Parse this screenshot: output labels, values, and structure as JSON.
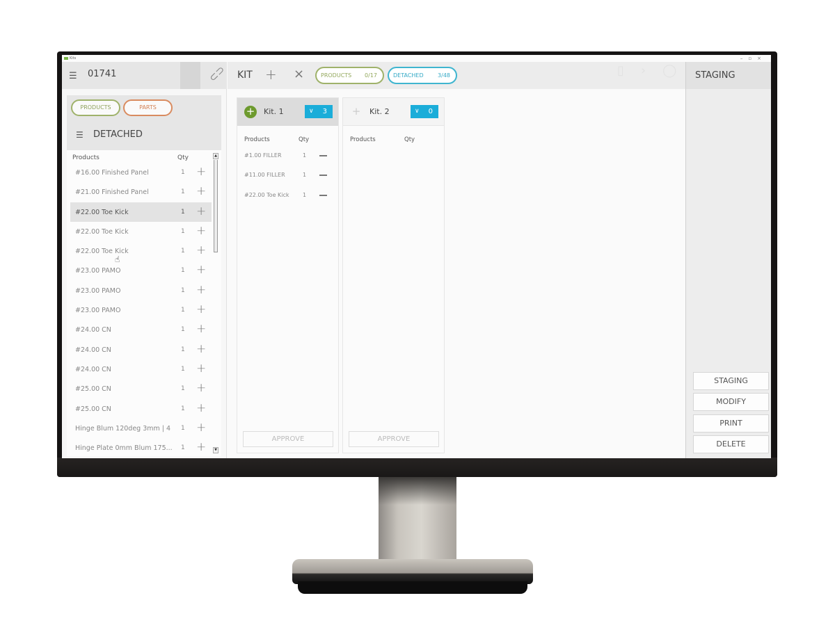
{
  "window": {
    "title": "Kits",
    "controls": [
      "–",
      "▫",
      "×"
    ]
  },
  "left_header": {
    "filter_icon": "sliders-icon",
    "order_number": "01741",
    "link_icon": "link-icon"
  },
  "main_header": {
    "title": "KIT",
    "add_icon": "+",
    "close_icon": "×",
    "pills": [
      {
        "label": "PRODUCTS",
        "count": "0/17",
        "color": "#9fb26a"
      },
      {
        "label": "DETACHED",
        "count": "3/48",
        "color": "#3fb5cf"
      }
    ],
    "faint_icons": [
      "bookmark-icon",
      "chevron-right-icon",
      "lightbulb-icon",
      "home-icon",
      "columns-icon"
    ]
  },
  "right_header": {
    "title": "STAGING"
  },
  "left_panel": {
    "filter_chips": [
      {
        "label": "PRODUCTS",
        "color": "#9fb26a"
      },
      {
        "label": "PARTS",
        "color": "#d98b5f"
      }
    ],
    "section_title": "DETACHED",
    "columns": {
      "product": "Products",
      "qty": "Qty"
    },
    "rows": [
      {
        "name": "#16.00 Finished Panel",
        "qty": "1"
      },
      {
        "name": "#21.00 Finished Panel",
        "qty": "1"
      },
      {
        "name": "#22.00 Toe Kick",
        "qty": "1",
        "hover": true
      },
      {
        "name": "#22.00 Toe Kick",
        "qty": "1"
      },
      {
        "name": "#22.00 Toe Kick",
        "qty": "1"
      },
      {
        "name": "#23.00 PAMO",
        "qty": "1"
      },
      {
        "name": "#23.00 PAMO",
        "qty": "1"
      },
      {
        "name": "#23.00 PAMO",
        "qty": "1"
      },
      {
        "name": "#24.00 CN",
        "qty": "1"
      },
      {
        "name": "#24.00 CN",
        "qty": "1"
      },
      {
        "name": "#24.00 CN",
        "qty": "1"
      },
      {
        "name": "#25.00 CN",
        "qty": "1"
      },
      {
        "name": "#25.00 CN",
        "qty": "1"
      },
      {
        "name": "Hinge Blum 120deg 3mm | 4",
        "qty": "1"
      },
      {
        "name": "Hinge Plate 0mm Blum 175...",
        "qty": "1"
      }
    ],
    "add_label": "+"
  },
  "kits": [
    {
      "name": "Kit. 1",
      "count": "3",
      "active": true,
      "columns": {
        "product": "Products",
        "qty": "Qty"
      },
      "rows": [
        {
          "name": "#1.00 FILLER",
          "qty": "1"
        },
        {
          "name": "#11.00 FILLER",
          "qty": "1"
        },
        {
          "name": "#22.00 Toe Kick",
          "qty": "1"
        }
      ],
      "approve_label": "APPROVE"
    },
    {
      "name": "Kit. 2",
      "count": "0",
      "active": false,
      "columns": {
        "product": "Products",
        "qty": "Qty"
      },
      "rows": [],
      "approve_label": "APPROVE"
    }
  ],
  "right_panel": {
    "actions": [
      "STAGING",
      "MODIFY",
      "PRINT",
      "DELETE"
    ]
  },
  "colors": {
    "accent_green": "#6d9a2e",
    "accent_blue": "#1badd9",
    "products_green": "#9fb26a",
    "parts_orange": "#d98b5f",
    "detached_cyan": "#3fb5cf"
  }
}
